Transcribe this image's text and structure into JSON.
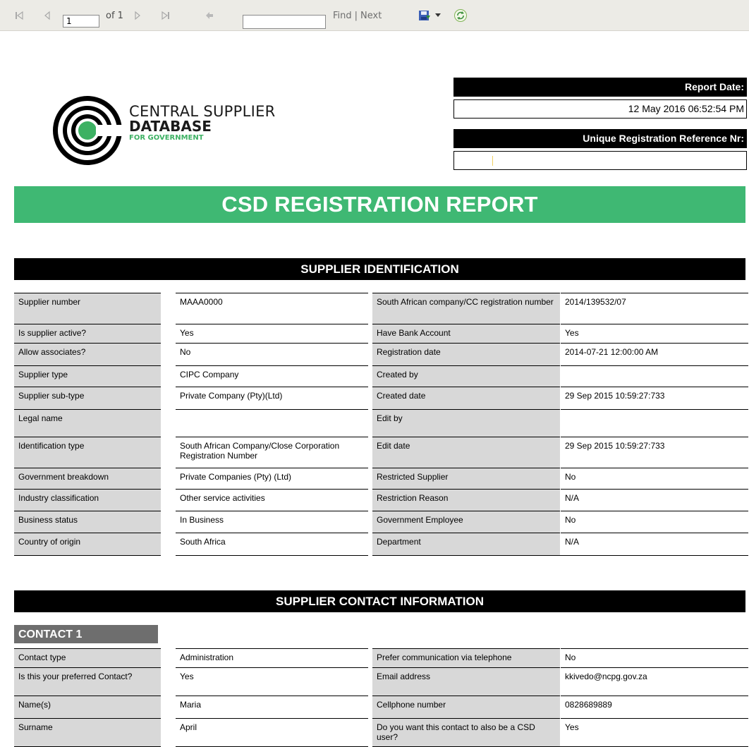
{
  "toolbar": {
    "page_value": "1",
    "page_of": "of 1",
    "find_placeholder": "",
    "find_label": "Find",
    "separator": "|",
    "next_label": "Next"
  },
  "logo": {
    "line1": "CENTRAL SUPPLIER",
    "line2": "DATABASE",
    "line3": "FOR GOVERNMENT"
  },
  "header": {
    "report_date_label": "Report Date:",
    "report_date_value": "12 May 2016 06:52:54 PM",
    "urn_label": "Unique Registration  Reference Nr:",
    "urn_value": ""
  },
  "banner": "CSD REGISTRATION REPORT",
  "supplier_identification": {
    "title": "SUPPLIER IDENTIFICATION",
    "rows": [
      {
        "l1": "Supplier number",
        "v1": "MAAA0000",
        "l2": "South African company/CC registration number",
        "v2": "2014/139532/07"
      },
      {
        "l1": "Is supplier active?",
        "v1": "Yes",
        "l2": "Have Bank Account",
        "v2": "Yes"
      },
      {
        "l1": "Allow associates?",
        "v1": "No",
        "l2": "Registration date",
        "v2": "2014-07-21 12:00:00 AM"
      },
      {
        "l1": "Supplier type",
        "v1": "CIPC Company",
        "l2": "Created by",
        "v2": ""
      },
      {
        "l1": "Supplier sub-type",
        "v1": "Private Company (Pty)(Ltd)",
        "l2": "Created date",
        "v2": "29 Sep 2015 10:59:27:733"
      },
      {
        "l1": "Legal name",
        "v1": "",
        "l2": "Edit by",
        "v2": ""
      },
      {
        "l1": "Identification type",
        "v1": "South African Company/Close Corporation Registration Number",
        "l2": "Edit date",
        "v2": "29 Sep 2015 10:59:27:733"
      },
      {
        "l1": "Government breakdown",
        "v1": "Private Companies (Pty) (Ltd)",
        "l2": "Restricted Supplier",
        "v2": "No"
      },
      {
        "l1": "Industry classification",
        "v1": "Other service activities",
        "l2": "Restriction Reason",
        "v2": "N/A"
      },
      {
        "l1": "Business status",
        "v1": "In Business",
        "l2": "Government Employee",
        "v2": "No"
      },
      {
        "l1": "Country of origin",
        "v1": "South Africa",
        "l2": "Department",
        "v2": "N/A"
      }
    ]
  },
  "contact_information": {
    "title": "SUPPLIER CONTACT INFORMATION",
    "contact_tag": "CONTACT 1",
    "rows": [
      {
        "l1": "Contact type",
        "v1": "Administration",
        "l2": "Prefer communication via telephone",
        "v2": "No"
      },
      {
        "l1": "Is this your preferred Contact?",
        "v1": "Yes",
        "l2": "Email address",
        "v2": "kkivedo@ncpg.gov.za"
      },
      {
        "l1": "Name(s)",
        "v1": "Maria",
        "l2": "Cellphone number",
        "v2": "0828689889"
      },
      {
        "l1": "Surname",
        "v1": "April",
        "l2": "Do you want this contact to also be a CSD user?",
        "v2": "Yes"
      }
    ]
  },
  "colors": {
    "accent_green": "#3fb873",
    "header_black": "#000000",
    "label_gray": "#d8d8d8",
    "toolbar_bg": "#ecebe6"
  },
  "icons": [
    "first-page-icon",
    "previous-page-icon",
    "next-page-icon",
    "last-page-icon",
    "back-icon",
    "export-save-icon",
    "dropdown-arrow-icon",
    "refresh-icon"
  ]
}
